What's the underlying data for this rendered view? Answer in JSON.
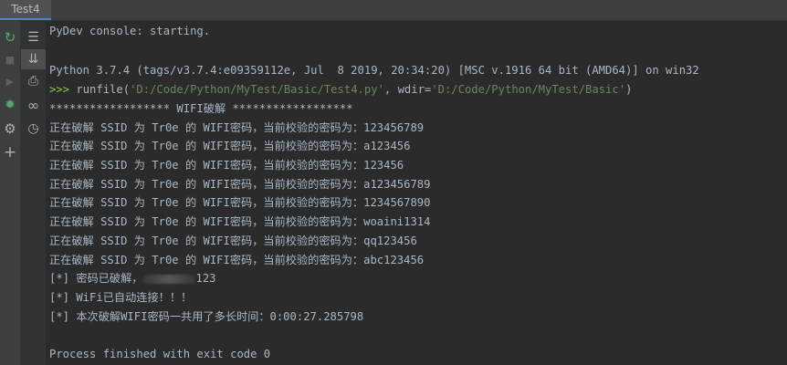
{
  "tab": {
    "label": "Test4"
  },
  "console": {
    "starting": "PyDev console: starting.",
    "python_version": "Python 3.7.4 (tags/v3.7.4:e09359112e, Jul  8 2019, 20:34:20) [MSC v.1916 64 bit (AMD64)] on win32",
    "prompt": ">>>",
    "runfile_prefix": " runfile(",
    "runfile_path": "'D:/Code/Python/MyTest/Basic/Test4.py'",
    "runfile_mid": ", wdir=",
    "runfile_wdir": "'D:/Code/Python/MyTest/Basic'",
    "runfile_suffix": ")",
    "banner": "****************** WIFI破解 ******************",
    "attempts": [
      "正在破解 SSID 为 Tr0e 的 WIFI密码，当前校验的密码为：123456789",
      "正在破解 SSID 为 Tr0e 的 WIFI密码，当前校验的密码为：a123456",
      "正在破解 SSID 为 Tr0e 的 WIFI密码，当前校验的密码为：123456",
      "正在破解 SSID 为 Tr0e 的 WIFI密码，当前校验的密码为：a123456789",
      "正在破解 SSID 为 Tr0e 的 WIFI密码，当前校验的密码为：1234567890",
      "正在破解 SSID 为 Tr0e 的 WIFI密码，当前校验的密码为：woaini1314",
      "正在破解 SSID 为 Tr0e 的 WIFI密码，当前校验的密码为：qq123456",
      "正在破解 SSID 为 Tr0e 的 WIFI密码，当前校验的密码为：abc123456"
    ],
    "cracked_prefix": "[*] 密码已破解，",
    "cracked_suffix": "123",
    "connected": "[*] WiFi已自动连接！！！",
    "elapsed": "[*] 本次破解WIFI密码一共用了多长时间：0:00:27.285798",
    "finished": "Process finished with exit code 0"
  },
  "icons": {
    "rerun": "↻",
    "stop": "■",
    "run": "▶",
    "debug": "✹",
    "settings": "⚙",
    "add": "+",
    "soft_wrap": "☰",
    "scroll_end": "⇊",
    "print": "⎙",
    "watch": "∞",
    "history": "◷"
  },
  "colors": {
    "background": "#2b2b2b",
    "text": "#a9b7c6",
    "string": "#6a8759",
    "prompt": "#8cc64a",
    "accent_tab": "#4a88c7",
    "rerun_icon": "#59a869",
    "debug_icon": "#59a869"
  }
}
